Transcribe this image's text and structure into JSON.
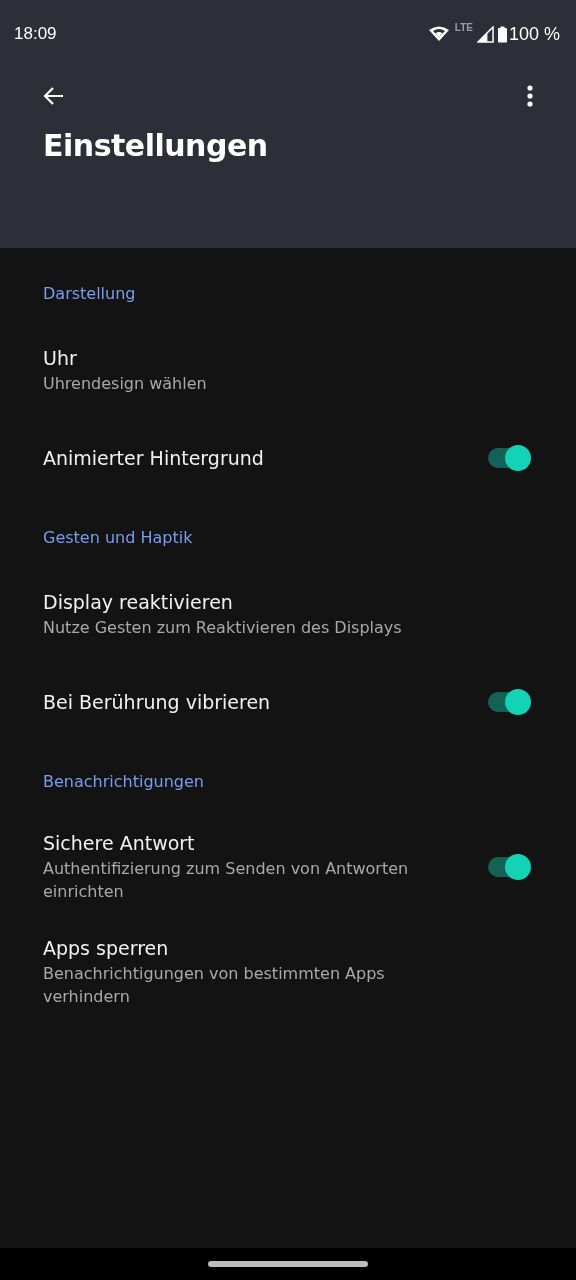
{
  "status_bar": {
    "time": "18:09",
    "network": "LTE",
    "battery": "100 %"
  },
  "toolbar": {
    "title": "Einstellungen"
  },
  "sections": [
    {
      "title": "Darstellung",
      "items": [
        {
          "kind": "text",
          "title": "Uhr",
          "summary": "Uhrendesign wählen"
        },
        {
          "kind": "switch",
          "title": "Animierter Hintergrund",
          "on": true
        }
      ]
    },
    {
      "title": "Gesten und Haptik",
      "items": [
        {
          "kind": "text",
          "title": "Display reaktivieren",
          "summary": "Nutze Gesten zum Reaktivieren des Displays"
        },
        {
          "kind": "switch",
          "title": "Bei Berührung vibrieren",
          "on": true
        }
      ]
    },
    {
      "title": "Benachrichtigungen",
      "items": [
        {
          "kind": "switch",
          "title": "Sichere Antwort",
          "summary": "Authentifizierung zum Senden von Antworten einrichten",
          "on": true
        },
        {
          "kind": "text",
          "title": "Apps sperren",
          "summary": "Benachrichtigungen von bestimmten Apps verhindern"
        }
      ]
    }
  ]
}
